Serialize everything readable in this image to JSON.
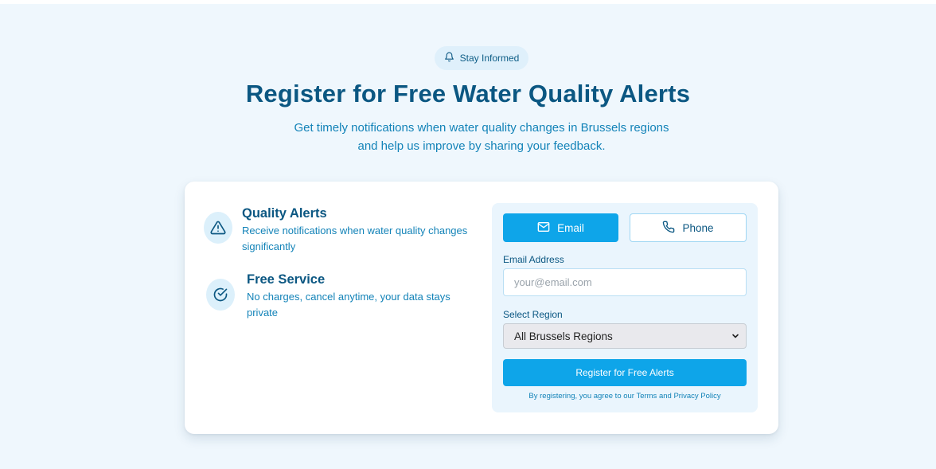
{
  "badge": {
    "label": "Stay Informed",
    "icon": "bell-icon"
  },
  "hero": {
    "title": "Register for Free Water Quality Alerts",
    "subtitle_line1": "Get timely notifications when water quality changes in Brussels regions",
    "subtitle_line2": "and help us improve by sharing your feedback."
  },
  "features": [
    {
      "title": "Quality Alerts",
      "desc_line1": "Receive notifications when water quality changes",
      "desc_line2": "significantly",
      "icon": "warning-triangle-icon"
    },
    {
      "title": "Free Service",
      "desc_line1": "No charges, cancel anytime, your data stays",
      "desc_line2": "private",
      "icon": "check-circle-icon"
    }
  ],
  "form": {
    "tabs": [
      {
        "label": "Email",
        "icon": "mail-icon",
        "active": true
      },
      {
        "label": "Phone",
        "icon": "phone-icon",
        "active": false
      }
    ],
    "email_label": "Email Address",
    "email_placeholder": "your@email.com",
    "region_label": "Select Region",
    "region_selected": "All Brussels Regions",
    "submit_label": "Register for Free Alerts",
    "terms_prefix": "By registering, you agree to our",
    "terms_link": "Terms",
    "terms_and": "and",
    "privacy_link": "Privacy Policy"
  },
  "colors": {
    "accent": "#0ea5e9",
    "heading": "#0b5782",
    "text": "#1383b8",
    "section_bg": "#eff7fd"
  }
}
